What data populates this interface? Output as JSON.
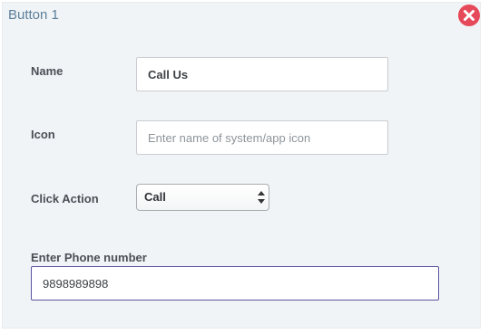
{
  "panel": {
    "title": "Button 1",
    "close_icon": "close-icon"
  },
  "colors": {
    "panel_bg": "#f1f4f6",
    "title": "#5c7f9b",
    "close": "#e64a5a",
    "focus_border": "#5b54a0"
  },
  "form": {
    "name": {
      "label": "Name",
      "value": "Call Us"
    },
    "icon": {
      "label": "Icon",
      "value": "",
      "placeholder": "Enter name of system/app icon"
    },
    "click_action": {
      "label": "Click Action",
      "selected": "Call",
      "arrows_icon": "up-down-arrows-icon"
    },
    "phone": {
      "label": "Enter Phone number",
      "value": "9898989898"
    }
  }
}
